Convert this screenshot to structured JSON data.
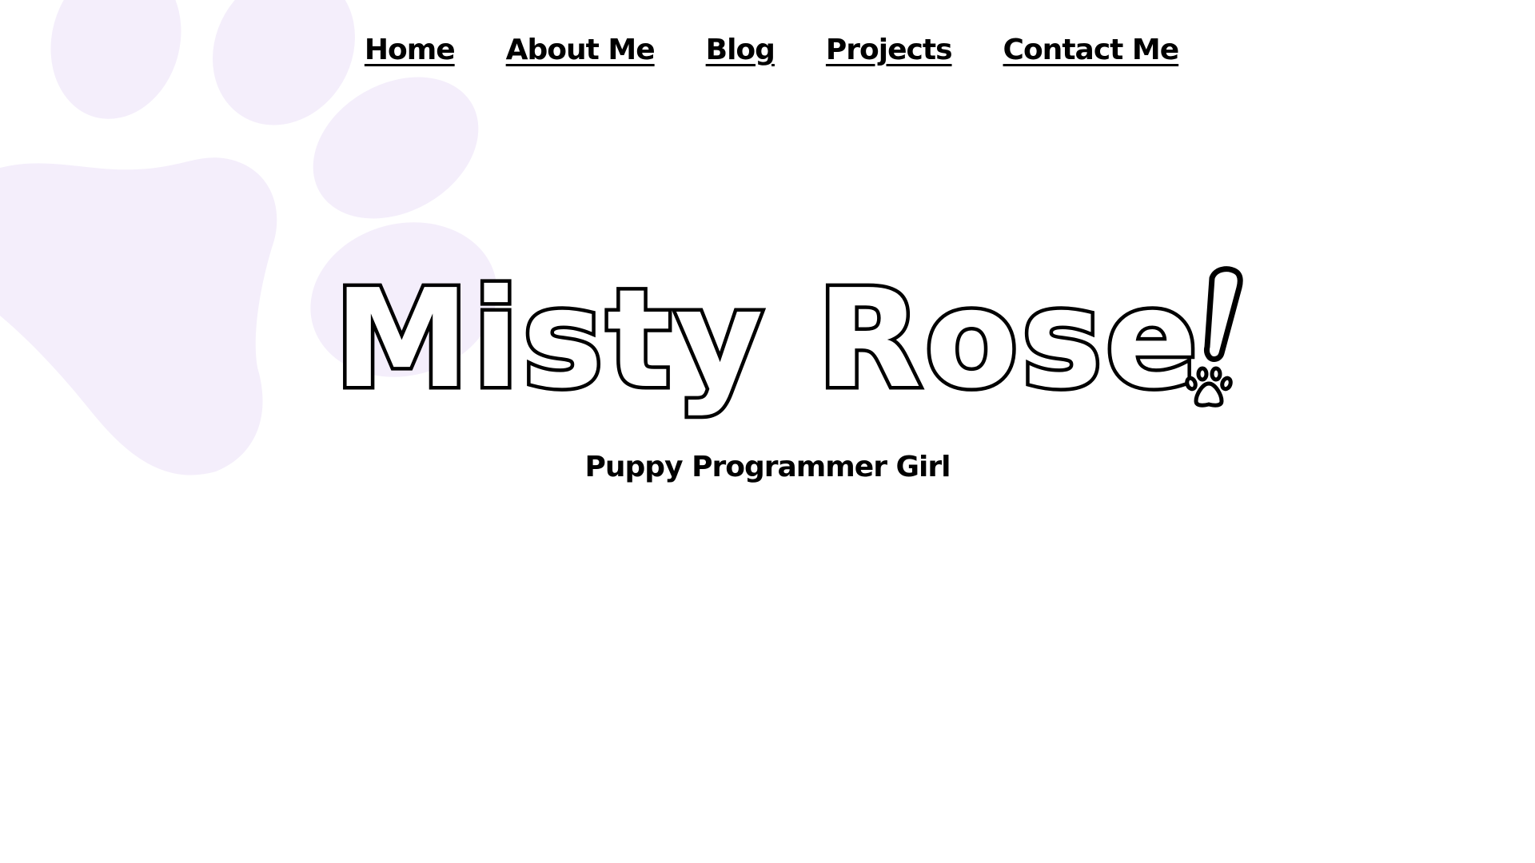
{
  "nav": {
    "items": [
      {
        "label": "Home"
      },
      {
        "label": "About Me"
      },
      {
        "label": "Blog"
      },
      {
        "label": "Projects"
      },
      {
        "label": "Contact Me"
      }
    ]
  },
  "hero": {
    "title": "Misty Rose",
    "tagline": "Puppy Programmer Girl"
  },
  "theme": {
    "paw_color": "#f4eefb",
    "text_color": "#000000",
    "background": "#ffffff"
  },
  "icons": {
    "background": "paw-print-icon",
    "title_accent": "paw-print-icon"
  }
}
